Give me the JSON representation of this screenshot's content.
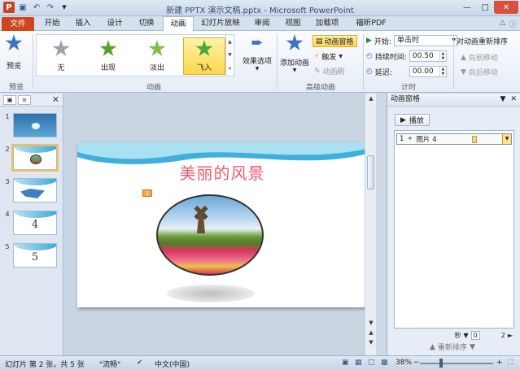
{
  "window": {
    "title": "新建 PPTX 演示文稿.pptx - Microsoft PowerPoint",
    "app_icon": "P",
    "colors": {
      "file_tab": "#d0451b",
      "accent": "#ffd64d"
    }
  },
  "tabs": [
    "文件",
    "开始",
    "插入",
    "设计",
    "切换",
    "动画",
    "幻灯片放映",
    "审阅",
    "视图",
    "加载项",
    "福昕PDF"
  ],
  "active_tab": "动画",
  "ribbon": {
    "preview": {
      "label": "预览",
      "group": "预览"
    },
    "gallery": {
      "items": [
        {
          "label": "无",
          "color": "#9aa3ad"
        },
        {
          "label": "出现",
          "color": "#5aa02c"
        },
        {
          "label": "淡出",
          "color": "#7cbf4a"
        },
        {
          "label": "飞入",
          "color": "#49a83a"
        }
      ],
      "selected": "飞入"
    },
    "effect_options": "效果选项",
    "animation_group": "动画",
    "add_animation": "添加动画",
    "animation_pane": "动画窗格",
    "trigger": "触发",
    "animation_painter": "动画刷",
    "advanced_group": "高级动画",
    "start_label": "开始:",
    "start_value": "单击时",
    "duration_label": "持续时间:",
    "duration_value": "00.50",
    "delay_label": "延迟:",
    "delay_value": "00.00",
    "timing_group": "计时",
    "reorder_title": "对动画重新排序",
    "move_earlier": "向前移动",
    "move_later": "向后移动"
  },
  "slides_pane": {
    "thumbnails": [
      {
        "num": "1",
        "text": ""
      },
      {
        "num": "2",
        "text": ""
      },
      {
        "num": "3",
        "text": ""
      },
      {
        "num": "4",
        "text": "4"
      },
      {
        "num": "5",
        "text": "5"
      }
    ],
    "active_slide": "2"
  },
  "slide": {
    "title": "美丽的风景",
    "anim_marker": "1"
  },
  "animation_pane": {
    "title": "动画窗格",
    "play_label": "播放",
    "items": [
      {
        "order": "1",
        "name": "图片 4"
      }
    ],
    "timeline_unit": "秒",
    "timeline_start": "0",
    "timeline_end": "2",
    "reorder_label": "重新排序"
  },
  "status": {
    "slide_info": "幻灯片 第 2 张，共 5 张",
    "theme": "\"流畅\"",
    "language": "中文(中国)",
    "zoom": "38%"
  }
}
